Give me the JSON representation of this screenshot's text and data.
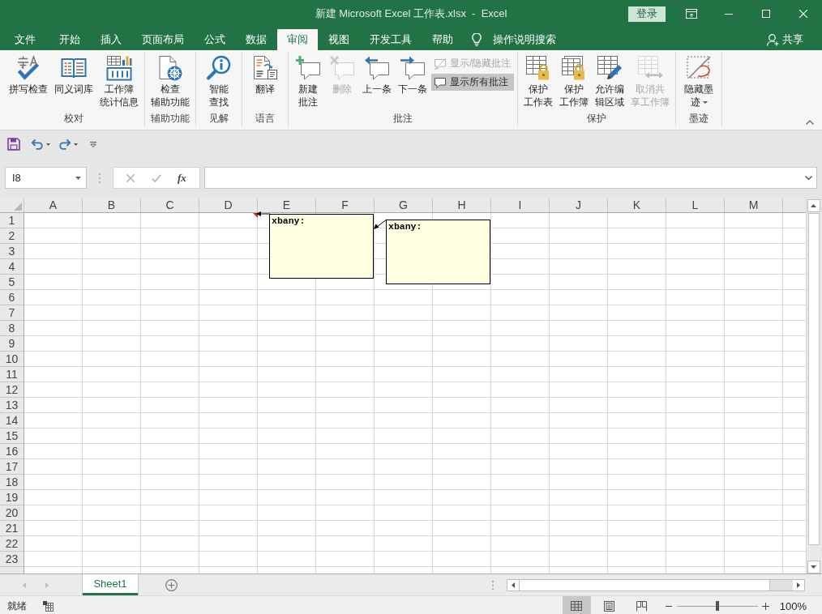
{
  "window": {
    "title": "新建 Microsoft Excel 工作表.xlsx  -  Excel",
    "sign_in": "登录"
  },
  "ribbon_tabs": [
    {
      "label": "文件",
      "selected": false
    },
    {
      "label": "开始",
      "selected": false
    },
    {
      "label": "插入",
      "selected": false
    },
    {
      "label": "页面布局",
      "selected": false
    },
    {
      "label": "公式",
      "selected": false
    },
    {
      "label": "数据",
      "selected": false
    },
    {
      "label": "审阅",
      "selected": true
    },
    {
      "label": "视图",
      "selected": false
    },
    {
      "label": "开发工具",
      "selected": false
    },
    {
      "label": "帮助",
      "selected": false
    }
  ],
  "tell_me": "操作说明搜索",
  "share": "共享",
  "ribbon_groups": [
    {
      "label": "校对",
      "commands": [
        {
          "kind": "large",
          "label": "拼写检查",
          "disabled": false,
          "on": false,
          "dropdown": false
        },
        {
          "kind": "large",
          "label": "同义词库",
          "disabled": false,
          "on": false,
          "dropdown": false
        },
        {
          "kind": "large",
          "label": "工作簿统计信息",
          "disabled": false,
          "on": false,
          "dropdown": false
        }
      ]
    },
    {
      "label": "辅助功能",
      "commands": [
        {
          "kind": "large",
          "label": "检查辅助功能",
          "disabled": false,
          "on": false,
          "dropdown": false
        }
      ]
    },
    {
      "label": "见解",
      "commands": [
        {
          "kind": "large",
          "label": "智能查找",
          "disabled": false,
          "on": false,
          "dropdown": false
        }
      ]
    },
    {
      "label": "语言",
      "commands": [
        {
          "kind": "large",
          "label": "翻译",
          "disabled": false,
          "on": false,
          "dropdown": false
        }
      ]
    },
    {
      "label": "批注",
      "commands": [
        {
          "kind": "large",
          "label": "新建批注",
          "disabled": false,
          "on": false,
          "dropdown": false
        },
        {
          "kind": "large",
          "label": "删除",
          "disabled": true,
          "on": false,
          "dropdown": false
        },
        {
          "kind": "large",
          "label": "上一条",
          "disabled": false,
          "on": false,
          "dropdown": false
        },
        {
          "kind": "large",
          "label": "下一条",
          "disabled": false,
          "on": false,
          "dropdown": false
        },
        {
          "kind": "small",
          "label": "显示/隐藏批注",
          "disabled": true,
          "on": false,
          "dropdown": false
        },
        {
          "kind": "small",
          "label": "显示所有批注",
          "disabled": false,
          "on": true,
          "dropdown": false
        }
      ]
    },
    {
      "label": "保护",
      "commands": [
        {
          "kind": "large",
          "label": "保护工作表",
          "disabled": false,
          "on": false,
          "dropdown": false
        },
        {
          "kind": "large",
          "label": "保护工作簿",
          "disabled": false,
          "on": false,
          "dropdown": false
        },
        {
          "kind": "large",
          "label": "允许编辑区域",
          "disabled": false,
          "on": false,
          "dropdown": false
        },
        {
          "kind": "large",
          "label": "取消共享工作簿",
          "disabled": true,
          "on": false,
          "dropdown": false
        }
      ]
    },
    {
      "label": "墨迹",
      "commands": [
        {
          "kind": "large",
          "label": "隐藏墨迹",
          "disabled": false,
          "on": false,
          "dropdown": true
        }
      ]
    }
  ],
  "name_box": {
    "value": "I8"
  },
  "formula_bar": {
    "function_button": "fx"
  },
  "sheet": {
    "columns": [
      "A",
      "B",
      "C",
      "D",
      "E",
      "F",
      "G",
      "H",
      "I",
      "J",
      "K",
      "L",
      "M"
    ],
    "rows": [
      "1",
      "2",
      "3",
      "4",
      "5",
      "6",
      "7",
      "8",
      "9",
      "10",
      "11",
      "12",
      "13",
      "14",
      "15",
      "16",
      "17",
      "18",
      "19",
      "20",
      "21",
      "22",
      "23"
    ],
    "comments": [
      {
        "text": "xbany:"
      },
      {
        "text": "xbany:"
      }
    ]
  },
  "sheet_tabs": [
    {
      "label": "Sheet1",
      "selected": true
    }
  ],
  "status_bar": {
    "status": "就绪",
    "views": [
      {
        "selected": true
      },
      {
        "selected": false
      },
      {
        "selected": false
      }
    ],
    "zoom_slider": {
      "level": 0.5
    },
    "zoom": "100%"
  }
}
